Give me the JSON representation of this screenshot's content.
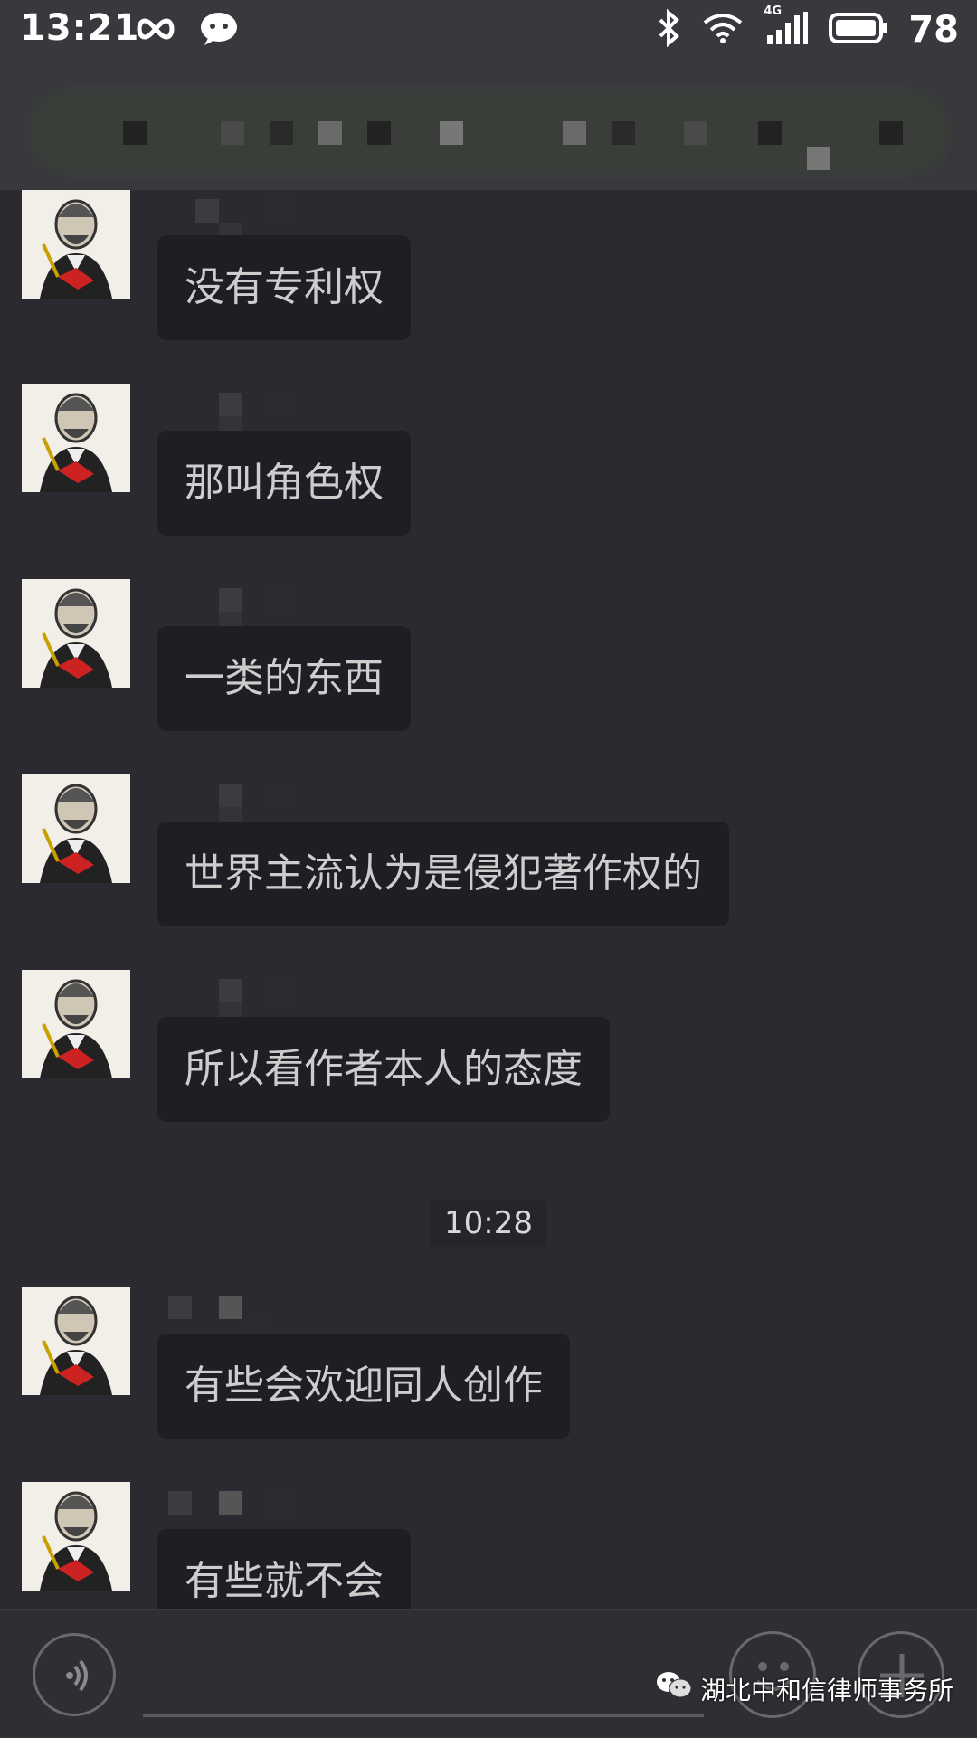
{
  "status_bar": {
    "time": "13:21",
    "network": "4G",
    "battery": "78"
  },
  "title": {
    "text": ""
  },
  "messages": [
    {
      "text": "没有专利权"
    },
    {
      "text": "那叫角色权"
    },
    {
      "text": "一类的东西"
    },
    {
      "text": "世界主流认为是侵犯著作权的"
    },
    {
      "text": "所以看作者本人的态度"
    },
    {
      "text": "有些会欢迎同人创作"
    },
    {
      "text": "有些就不会"
    }
  ],
  "timestamp": "10:28",
  "watermark": "湖北中和信律师事务所",
  "colors": {
    "background": "#2a2a30",
    "bubble": "#1f1e24",
    "status_bar": "#38383d"
  }
}
